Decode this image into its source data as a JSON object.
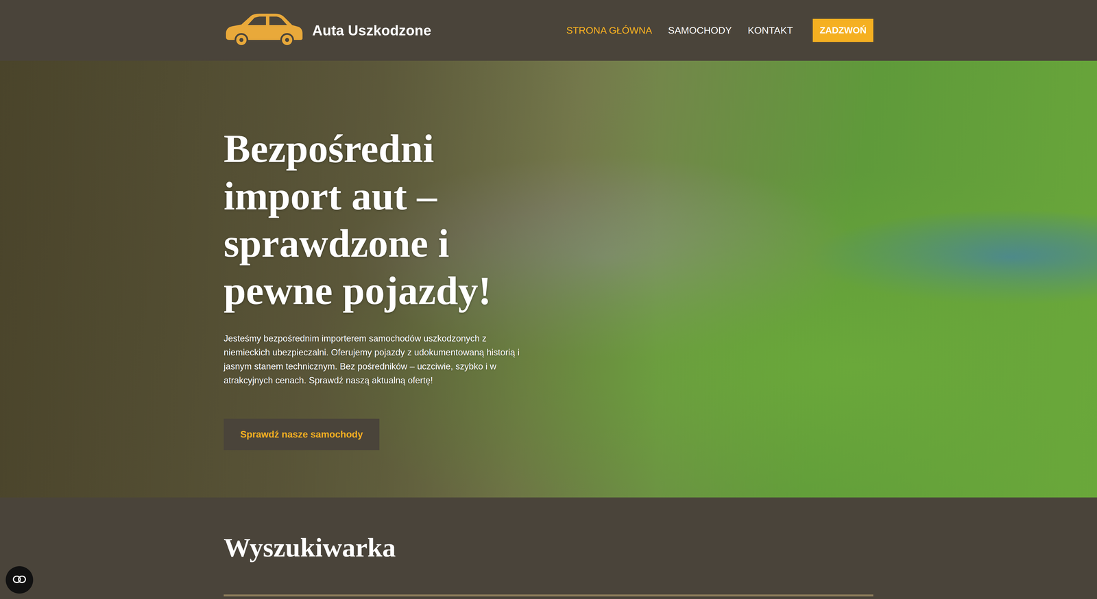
{
  "header": {
    "logo_text": "Auta Uszkodzone",
    "nav": [
      {
        "label": "STRONA GŁÓWNA",
        "selected": true
      },
      {
        "label": "SAMOCHODY",
        "selected": false
      },
      {
        "label": "KONTAKT",
        "selected": false
      }
    ],
    "call_button": "ZADZWOŃ"
  },
  "hero": {
    "title": "Bezpośredni import aut – sprawdzone i pewne pojazdy!",
    "text": "Jesteśmy bezpośrednim importerem samochodów uszkodzonych z niemieckich ubezpieczalni. Oferujemy pojazdy z udokumentowaną historią i jasnym stanem technicznym. Bez pośredników – uczciwie, szybko i w atrakcyjnych cenach. Sprawdź naszą aktualną ofertę!",
    "button": "Sprawdź nasze samochody"
  },
  "search_section": {
    "title": "Wyszukiwarka"
  }
}
